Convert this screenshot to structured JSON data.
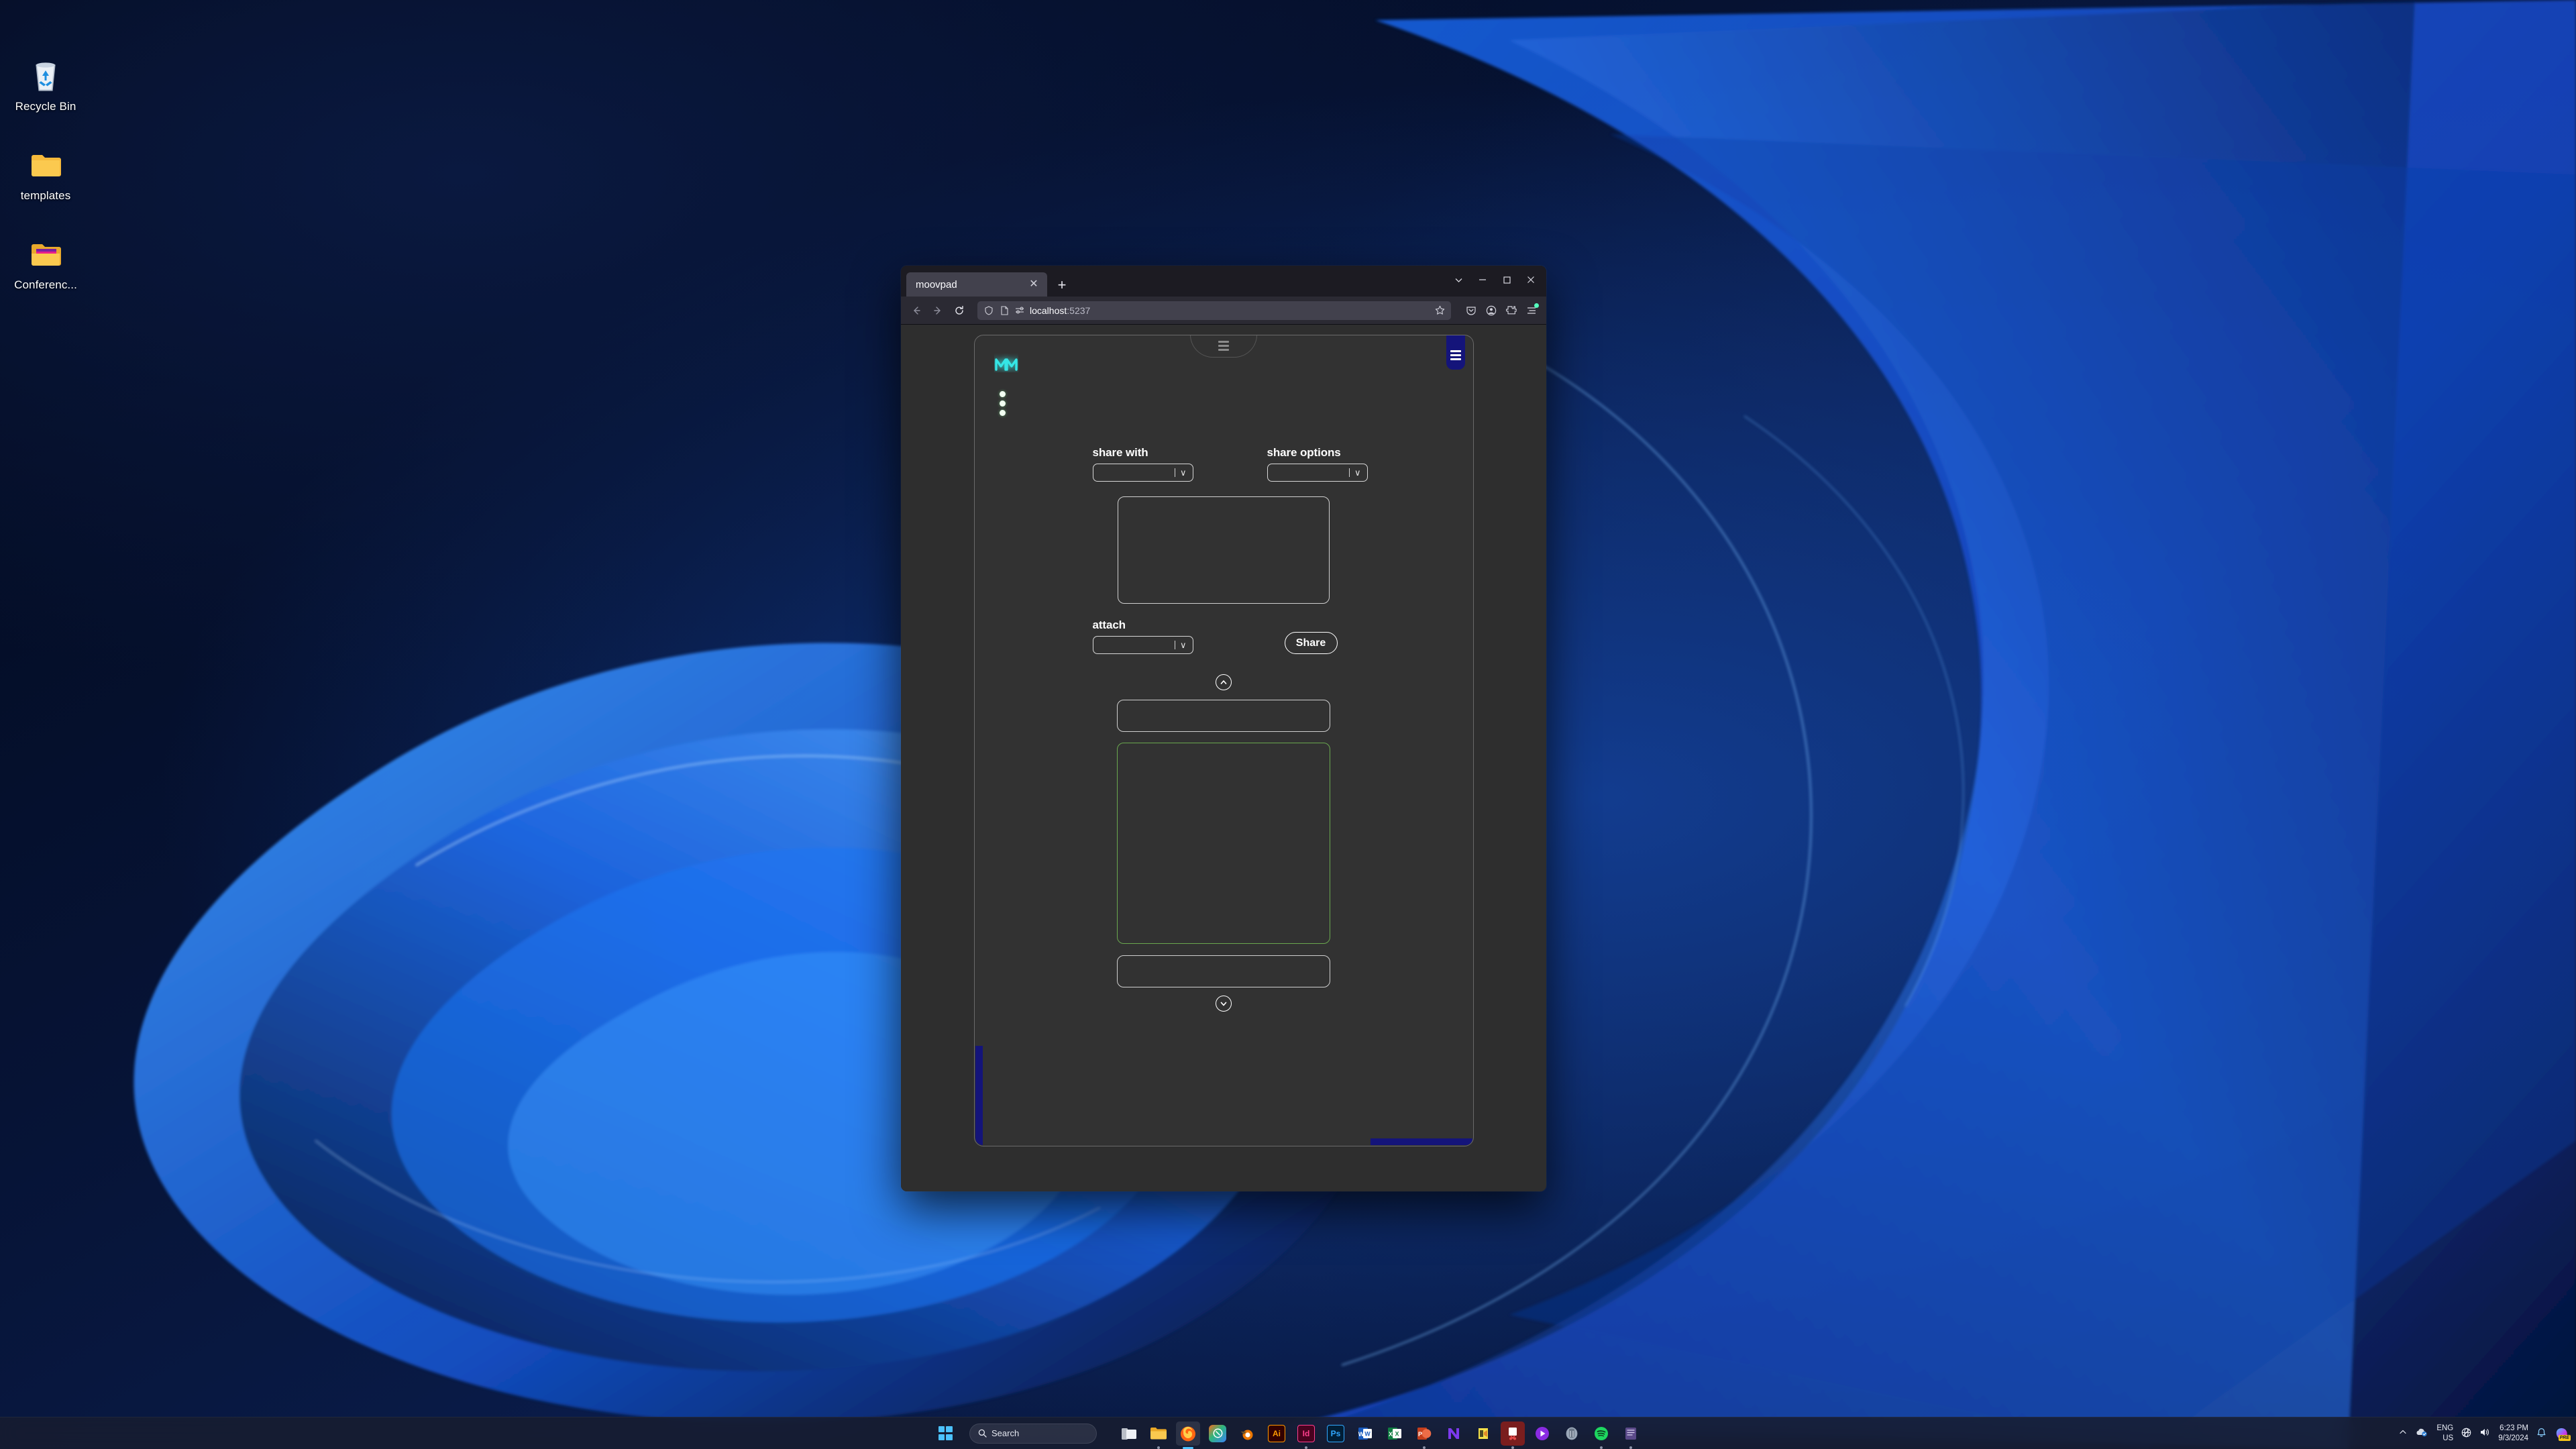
{
  "desktop": {
    "icons": [
      {
        "label": "Recycle Bin",
        "icon": "recycle-bin-icon"
      },
      {
        "label": "templates",
        "icon": "folder-icon"
      },
      {
        "label": "Conferenc...",
        "icon": "folder-open-icon"
      }
    ]
  },
  "browser": {
    "tab": {
      "title": "moovpad",
      "close_label": "✕",
      "new_tab_label": "+"
    },
    "window_controls": {
      "list_label": "∨",
      "minimize_label": "–",
      "maximize_label": "❐",
      "close_label": "✕"
    },
    "nav": {
      "back_icon": "back-arrow-icon",
      "forward_icon": "forward-arrow-icon",
      "reload_icon": "reload-icon"
    },
    "urlbar": {
      "shield_icon": "shield-icon",
      "page_icon": "page-icon",
      "permissions_icon": "permissions-icon",
      "host": "localhost",
      "port": ":5237",
      "bookmark_icon": "star-icon"
    },
    "toolbar_right": [
      {
        "icon": "pocket-icon"
      },
      {
        "icon": "account-icon"
      },
      {
        "icon": "extensions-icon"
      },
      {
        "icon": "app-menu-icon",
        "badge": true
      }
    ]
  },
  "app": {
    "name": "moovpad",
    "logo_icon": "moovpad-m-logo",
    "logo_color": "#35e6e6",
    "accent_blue": "#14147a",
    "accent_green": "#6aa84f",
    "top_tab_icon": "menu-lines-icon",
    "side_tab_icon": "menu-lines-icon",
    "kebab_icon": "vertical-dots-icon",
    "fields": {
      "share_with": {
        "label": "share with",
        "value": "",
        "chevron": "∨"
      },
      "share_options": {
        "label": "share options",
        "value": "",
        "chevron": "∨"
      },
      "attach": {
        "label": "attach",
        "value": "",
        "chevron": "∨"
      }
    },
    "share_button": {
      "label": "Share"
    },
    "carousel": {
      "up_icon": "chevron-up-icon",
      "down_icon": "chevron-down-icon",
      "prev_icon": "chevron-left-icon",
      "next_icon": "chevron-right-icon"
    }
  },
  "taskbar": {
    "start_label": "start-button",
    "search": {
      "placeholder": "Search",
      "icon": "search-icon"
    },
    "apps": [
      {
        "name": "file-explorer",
        "label": "",
        "color": "#d8dbe0",
        "running": false
      },
      {
        "name": "folder",
        "label": "",
        "color": "#f0b429",
        "running": false
      },
      {
        "name": "firefox",
        "label": "",
        "color": "#ff7139",
        "running": true,
        "active": true
      },
      {
        "name": "notion-calendar",
        "label": "",
        "color": "#2eb67d",
        "running": false
      },
      {
        "name": "blender",
        "label": "",
        "color": "#ea7600",
        "running": false
      },
      {
        "name": "adobe-illustrator",
        "label": "Ai",
        "color": "#330000",
        "running": false
      },
      {
        "name": "adobe-indesign",
        "label": "Id",
        "color": "#49021f",
        "running": true
      },
      {
        "name": "adobe-photoshop",
        "label": "Ps",
        "color": "#001e36",
        "running": false
      },
      {
        "name": "microsoft-word",
        "label": "W",
        "color": "#185abd",
        "running": false
      },
      {
        "name": "microsoft-excel",
        "label": "X",
        "color": "#107c41",
        "running": false
      },
      {
        "name": "microsoft-powerpoint",
        "label": "P",
        "color": "#c43e1c",
        "running": true
      },
      {
        "name": "affinity",
        "label": "",
        "color": "#6b2fa0",
        "running": false
      },
      {
        "name": "sublime-text",
        "label": "",
        "color": "#e8d44d",
        "running": false
      },
      {
        "name": "snipping-tool",
        "label": "",
        "color": "#7a1e1e",
        "running": true,
        "boxed": true
      },
      {
        "name": "media-player",
        "label": "",
        "color": "#8a2be2",
        "running": false
      },
      {
        "name": "postgresql",
        "label": "",
        "color": "#9aa7b8",
        "running": false
      },
      {
        "name": "spotify",
        "label": "",
        "color": "#1ed760",
        "running": true
      },
      {
        "name": "notes",
        "label": "",
        "color": "#5b4a8a",
        "running": true
      }
    ],
    "tray": {
      "chevron_icon": "chevron-up-icon",
      "cloud_sync_icon": "onedrive-icon",
      "language": "ENG",
      "locale": "US",
      "network_icon": "network-icon",
      "volume_icon": "volume-icon",
      "time": "6:23 PM",
      "date": "9/3/2024",
      "notification_icon": "bell-icon",
      "copilot_icon": "copilot-icon",
      "copilot_badge": "PRE"
    }
  }
}
